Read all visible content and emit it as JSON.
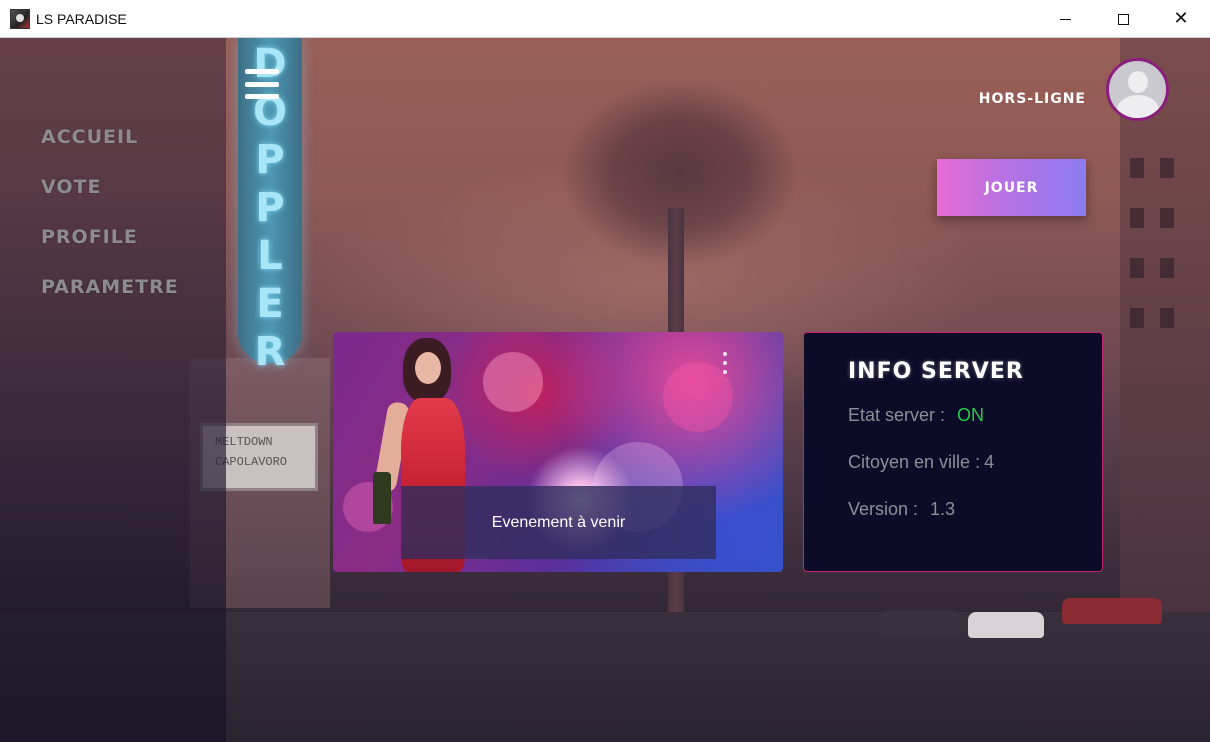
{
  "window": {
    "title": "LS PARADISE",
    "icon": "app-logo-icon",
    "controls": [
      "minimize-icon",
      "maximize-icon",
      "close-icon"
    ],
    "close_glyph": "✕"
  },
  "background": {
    "sign_letters": [
      "D",
      "O",
      "P",
      "P",
      "L",
      "E",
      "R"
    ],
    "theater_sign_lines": [
      "MELTDOWN",
      "CAPOLAVORO"
    ]
  },
  "sidebar": {
    "items": [
      {
        "label": "ACCUEIL"
      },
      {
        "label": "VOTE"
      },
      {
        "label": "PROFILE"
      },
      {
        "label": "PARAMETRE"
      }
    ]
  },
  "header": {
    "menu_icon": "hamburger-menu-icon",
    "status": "HORS-LIGNE",
    "avatar_icon": "user-avatar-icon"
  },
  "actions": {
    "play_label": "JOUER"
  },
  "event_card": {
    "caption": "Evenement à venir",
    "menu_icon": "more-vertical-icon"
  },
  "info_server": {
    "title": "INFO SERVER",
    "state_label": "Etat server :",
    "state_value": "ON",
    "citizens_label": "Citoyen en ville :",
    "citizens_value": "4",
    "version_label": "Version :",
    "version_value": "1.3"
  },
  "colors": {
    "accent_pink": "#e66cd6",
    "accent_purple": "#8c7cf0",
    "status_on": "#2ac94a",
    "card_border": "#c2266c",
    "card_bg": "#0c0c28"
  }
}
